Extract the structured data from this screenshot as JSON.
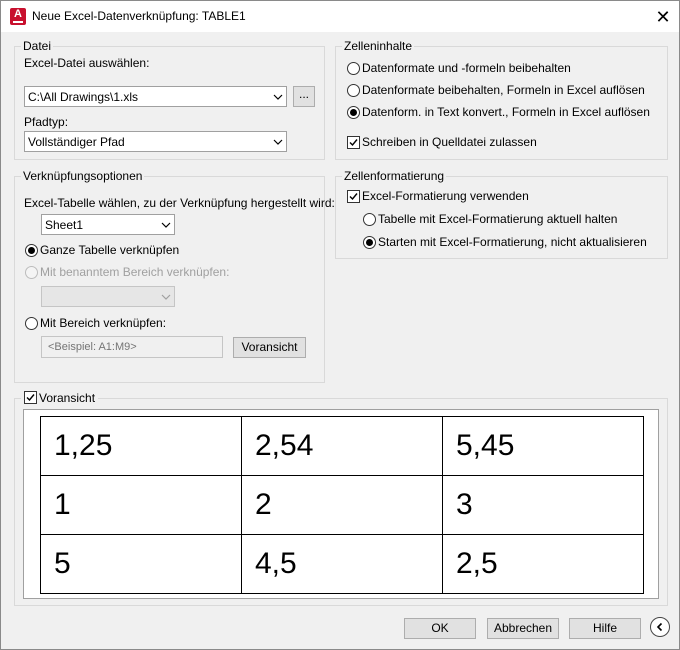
{
  "window": {
    "title": "Neue Excel-Datenverknüpfung: TABLE1",
    "close_glyph": "✕",
    "app_icon_letter": "A"
  },
  "datei": {
    "legend": "Datei",
    "file_label": "Excel-Datei auswählen:",
    "file_value": "C:\\All Drawings\\1.xls",
    "browse_label": "...",
    "pathtype_label": "Pfadtyp:",
    "pathtype_value": "Vollständiger Pfad"
  },
  "zelleninhalte": {
    "legend": "Zelleninhalte",
    "options": [
      {
        "label": "Datenformate und -formeln beibehalten",
        "selected": false
      },
      {
        "label": "Datenformate beibehalten, Formeln in Excel auflösen",
        "selected": false
      },
      {
        "label": "Datenform. in Text konvert., Formeln in Excel auflösen",
        "selected": true
      }
    ],
    "write_source_label": "Schreiben in Quelldatei zulassen",
    "write_source_checked": true
  },
  "verknuepfung": {
    "legend": "Verknüpfungsoptionen",
    "sheet_label": "Excel-Tabelle wählen, zu der Verknüpfung hergestellt wird:",
    "sheet_value": "Sheet1",
    "whole_table_label": "Ganze Tabelle verknüpfen",
    "named_range_label": "Mit benanntem Bereich verknüpfen:",
    "named_range_value": "",
    "range_label": "Mit Bereich verknüpfen:",
    "range_placeholder": "<Beispiel: A1:M9>",
    "preview_button": "Voransicht"
  },
  "zellenformatierung": {
    "legend": "Zellenformatierung",
    "use_excel_label": "Excel-Formatierung verwenden",
    "use_excel_checked": true,
    "keep_updated_label": "Tabelle mit Excel-Formatierung aktuell halten",
    "start_only_label": "Starten mit Excel-Formatierung, nicht aktualisieren"
  },
  "preview": {
    "label": "Voransicht",
    "checked": true,
    "rows": [
      [
        "1,25",
        "2,54",
        "5,45"
      ],
      [
        "1",
        "2",
        "3"
      ],
      [
        "5",
        "4,5",
        "2,5"
      ]
    ]
  },
  "footer": {
    "ok": "OK",
    "cancel": "Abbrechen",
    "help": "Hilfe"
  },
  "icons": {
    "app": "autocad-icon",
    "close": "close-icon",
    "dropdown": "chevron-down-icon",
    "collapse": "chevron-left-circle-icon"
  },
  "colors": {
    "accent": "#c8102e",
    "dialog_bg": "#f0f0f0",
    "button_bg": "#e1e1e1"
  }
}
